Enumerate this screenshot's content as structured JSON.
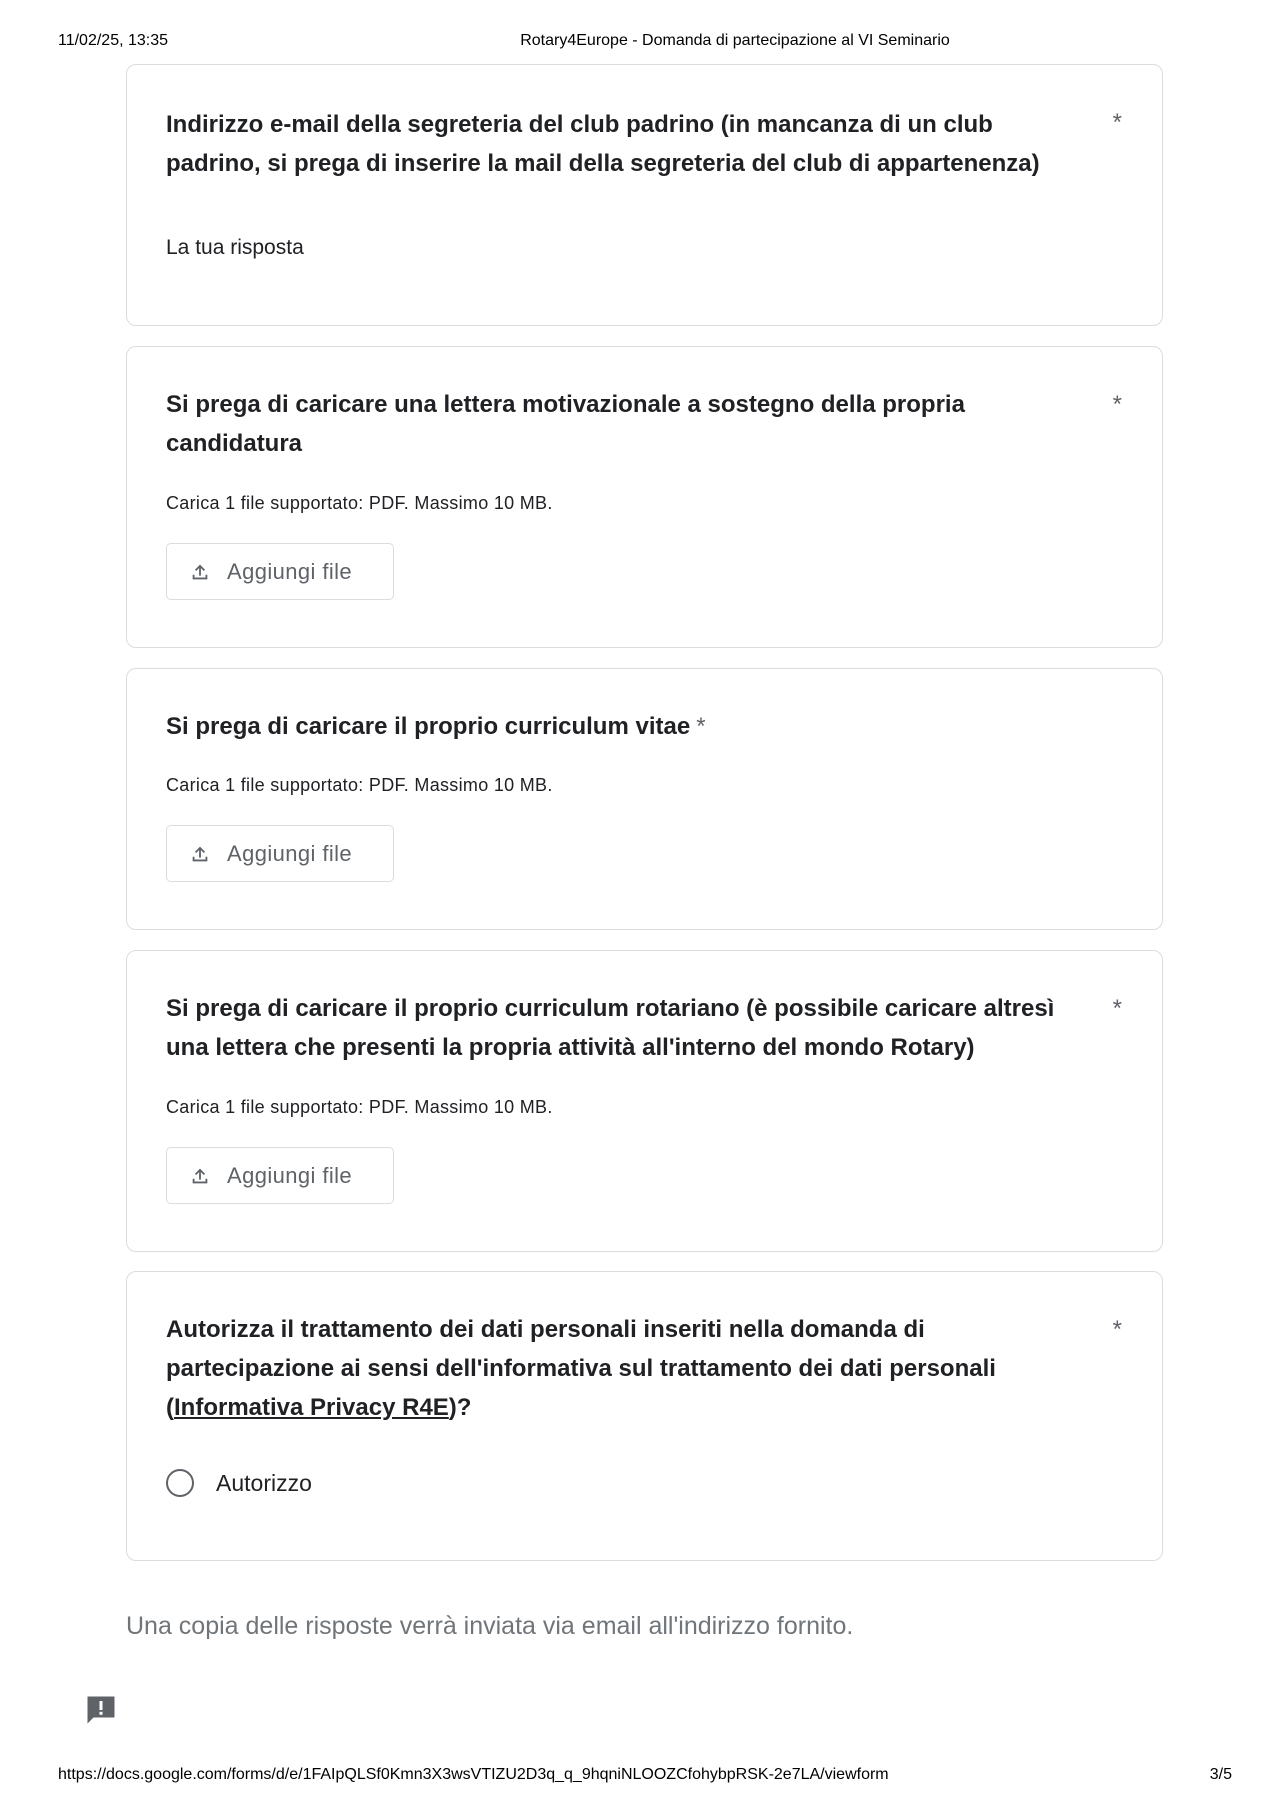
{
  "print_header": {
    "datetime": "11/02/25, 13:35",
    "doc_title": "Rotary4Europe - Domanda di partecipazione al VI Seminario"
  },
  "questions": [
    {
      "title": "Indirizzo e-mail della segreteria del club padrino (in mancanza di un club padrino, si prega di inserire la mail della segreteria del club di appartenenza)",
      "required_mark": "*",
      "answer_placeholder": "La tua risposta"
    },
    {
      "title": "Si prega di caricare una lettera motivazionale a sostegno della propria candidatura",
      "required_mark": "*",
      "hint": "Carica 1 file supportato: PDF. Massimo 10 MB.",
      "button_label": "Aggiungi file"
    },
    {
      "title": "Si prega di caricare il proprio curriculum vitae",
      "required_mark": "*",
      "hint": "Carica 1 file supportato: PDF. Massimo 10 MB.",
      "button_label": "Aggiungi file"
    },
    {
      "title": "Si prega di caricare il proprio curriculum rotariano (è possibile caricare altresì una lettera che presenti la propria attività all'interno del mondo Rotary)",
      "required_mark": "*",
      "hint": "Carica 1 file supportato: PDF. Massimo 10 MB.",
      "button_label": "Aggiungi file"
    },
    {
      "title_before": "Autorizza il trattamento dei dati personali inseriti nella domanda di partecipazione ai sensi dell'informativa sul trattamento dei dati personali (",
      "link_text": "Informativa Privacy R4E",
      "title_after": ")?",
      "required_mark": "*",
      "option_label": "Autorizzo"
    }
  ],
  "footer_note": "Una copia delle risposte verrà inviata via email all'indirizzo fornito.",
  "icons": {
    "upload": "upload-icon",
    "report": "report-problem-icon"
  },
  "print_footer": {
    "url": "https://docs.google.com/forms/d/e/1FAIpQLSf0Kmn3X3wsVTIZU2D3q_q_9hqniNLOOZCfohybpRSK-2e7LA/viewform",
    "page": "3/5"
  }
}
